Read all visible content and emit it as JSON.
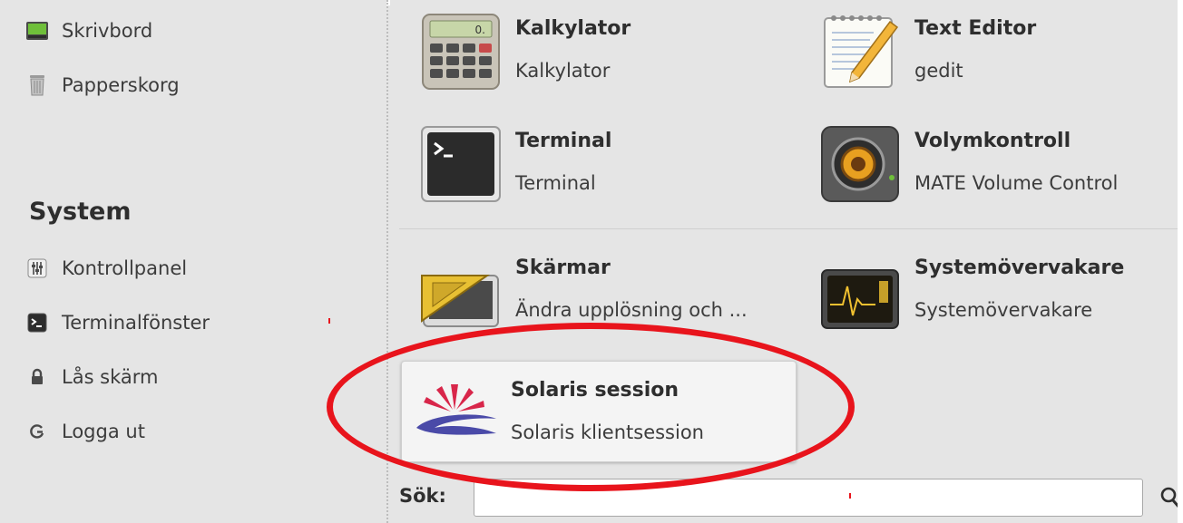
{
  "sidebar": {
    "places": [
      {
        "label": "Skrivbord",
        "icon": "desktop-icon"
      },
      {
        "label": "Papperskorg",
        "icon": "trash-icon"
      }
    ],
    "system_title": "System",
    "system": [
      {
        "label": "Kontrollpanel",
        "icon": "control-panel-icon"
      },
      {
        "label": "Terminalfönster",
        "icon": "terminal-small-icon"
      },
      {
        "label": "Lås skärm",
        "icon": "lock-icon"
      },
      {
        "label": "Logga ut",
        "icon": "logout-icon"
      }
    ]
  },
  "apps": [
    {
      "name": "Kalkylator",
      "desc": "Kalkylator",
      "icon": "calculator-icon"
    },
    {
      "name": "Text Editor",
      "desc": "gedit",
      "icon": "text-editor-icon"
    },
    {
      "name": "Terminal",
      "desc": "Terminal",
      "icon": "terminal-icon"
    },
    {
      "name": "Volymkontroll",
      "desc": "MATE Volume Control",
      "icon": "speaker-icon"
    },
    {
      "name": "Skärmar",
      "desc": "Ändra upplösning och ...",
      "icon": "display-icon"
    },
    {
      "name": "Systemövervakare",
      "desc": "Systemövervakare",
      "icon": "system-monitor-icon"
    },
    {
      "name": "Solaris session",
      "desc": "Solaris klientsession",
      "icon": "solaris-logo-icon"
    }
  ],
  "search": {
    "label": "Sök:",
    "value": "",
    "icon": "search-icon"
  },
  "colors": {
    "background": "#e5e5e5",
    "annotation": "#e8141c",
    "highlight": "#f4f4f4"
  }
}
